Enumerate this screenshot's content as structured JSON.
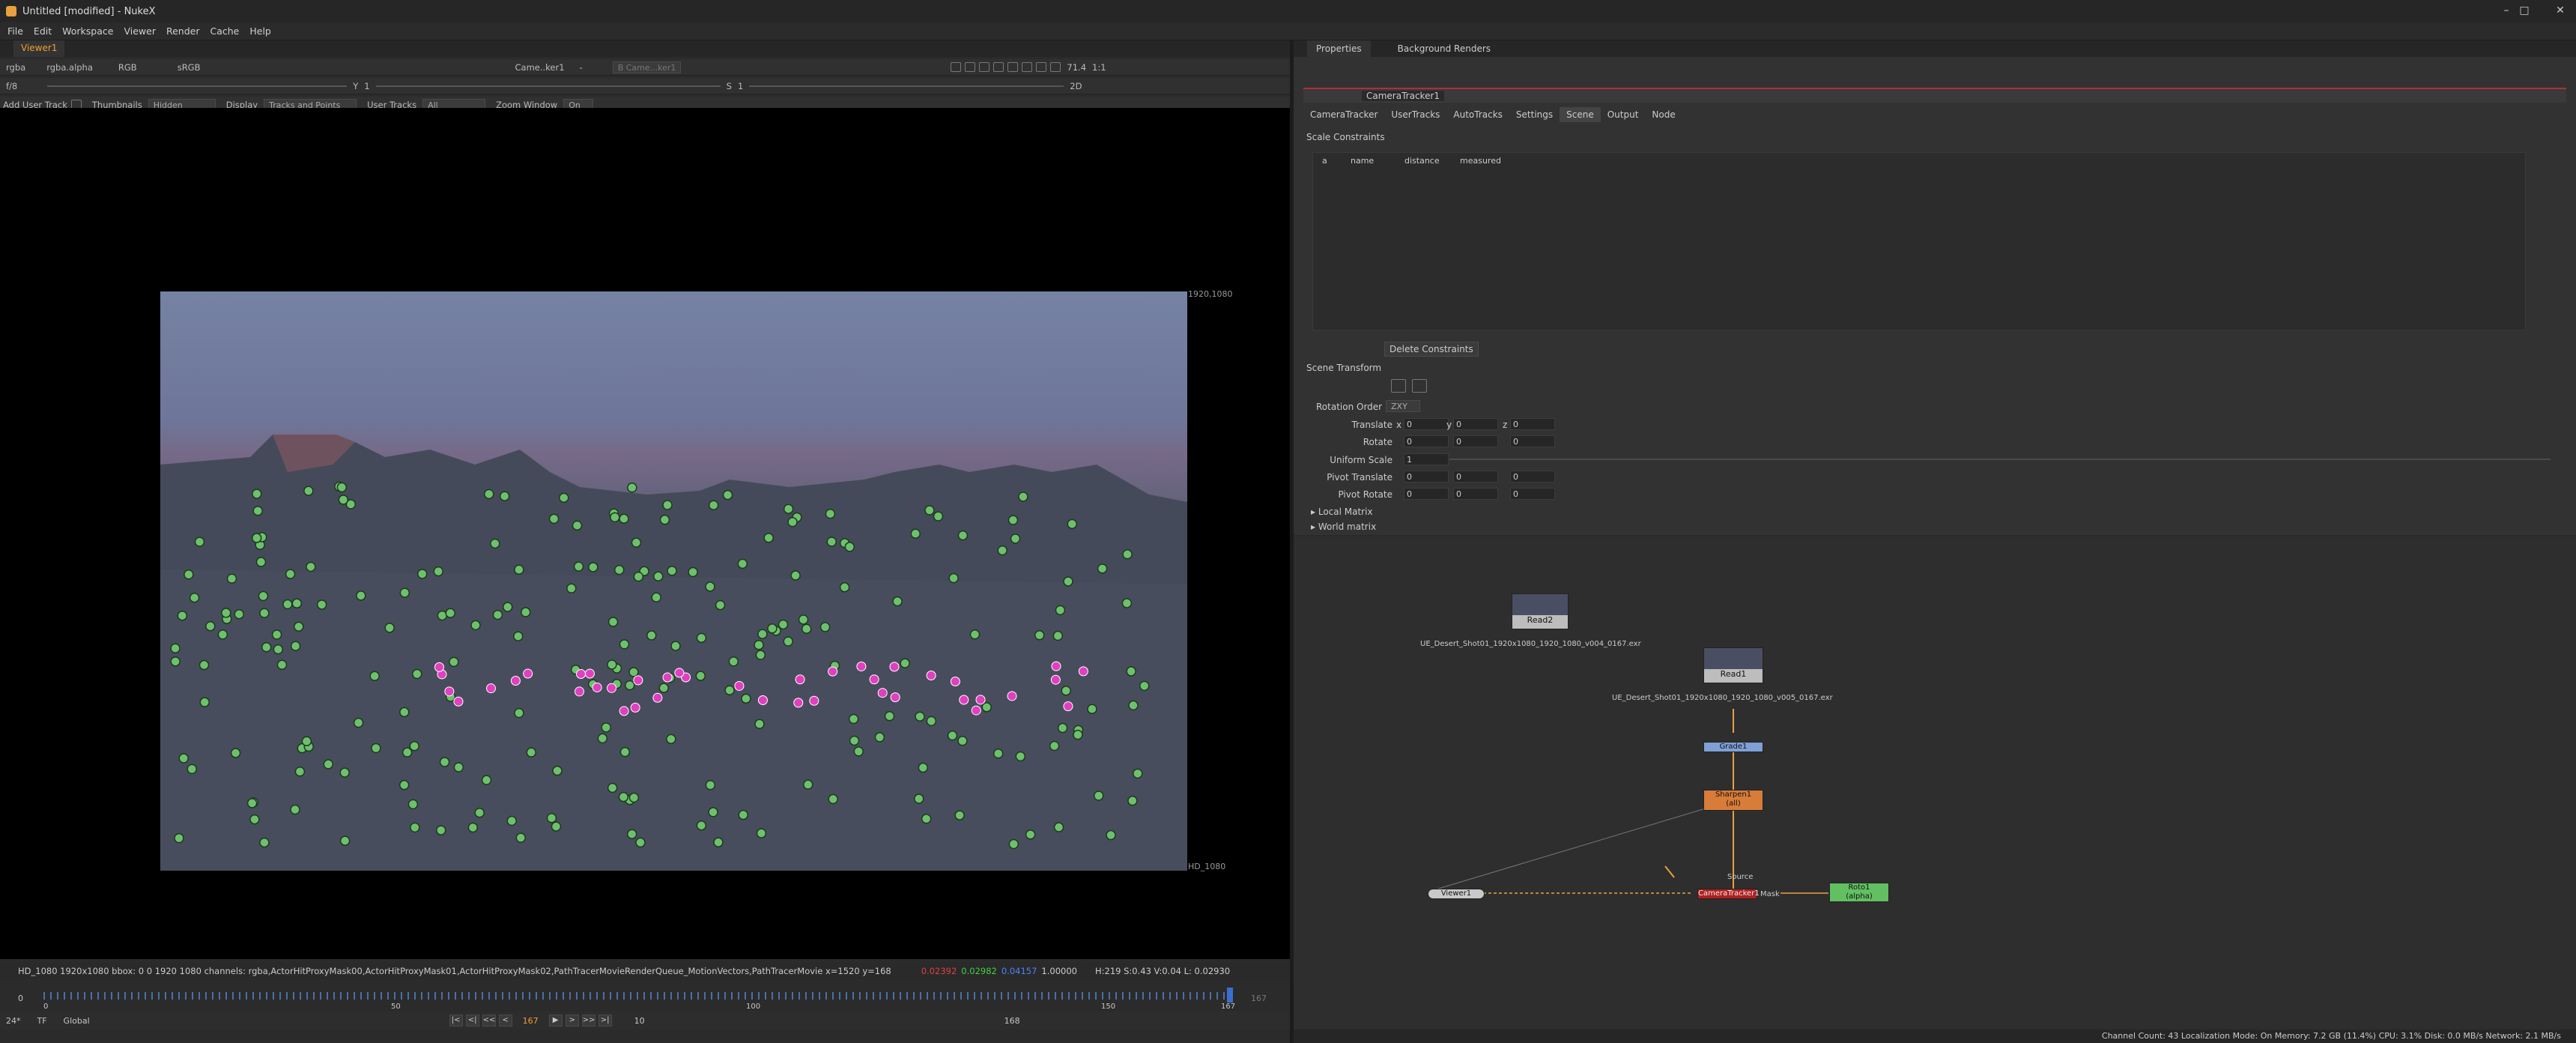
{
  "window": {
    "title": "Untitled [modified] - NukeX"
  },
  "menu": [
    "File",
    "Edit",
    "Workspace",
    "Viewer",
    "Render",
    "Cache",
    "Help"
  ],
  "viewer": {
    "tab": "Viewer1",
    "channels": "rgba",
    "channel_alpha": "rgba.alpha",
    "display_ch": "RGB",
    "colorspace": "sRGB",
    "input_a": "Came..ker1",
    "input_b": "B  Came...ker1",
    "dash": "-",
    "zoom": "71.4",
    "ratio": "1:1",
    "frame_field": "f/8",
    "y_label": "Y",
    "y_val": "1",
    "s_label": "S",
    "s_val": "1",
    "mode_2d": "2D",
    "tools": {
      "add_user_track": "Add User Track",
      "thumbnails_label": "Thumbnails",
      "thumbnails_value": "Hidden",
      "display_label": "Display",
      "display_value": "Tracks and Points",
      "user_tracks_label": "User Tracks",
      "user_tracks_value": "All",
      "zoom_window_label": "Zoom Window",
      "zoom_window_value": "On"
    },
    "format_top": "1920,1080",
    "format_bottom": "HD_1080",
    "info": "HD_1080 1920x1080  bbox: 0 0 1920 1080 channels: rgba,ActorHitProxyMask00,ActorHitProxyMask01,ActorHitProxyMask02,PathTracerMovieRenderQueue_MotionVectors,PathTracerMovie  x=1520 y=168",
    "pixel_r": "0.02392",
    "pixel_g": "0.02982",
    "pixel_b": "0.04157",
    "pixel_a": "1.00000",
    "hsvl": "H:219 S:0.43 V:0.04  L: 0.02930",
    "timeline": {
      "start": "0",
      "end": "167",
      "ticks": [
        "0",
        "50",
        "100",
        "150",
        "167"
      ],
      "current": "167"
    },
    "playbar": {
      "fps": "24*",
      "tf": "TF",
      "scope": "Global",
      "frame": "167",
      "step": "10",
      "end_frame": "168"
    }
  },
  "properties": {
    "tabs": [
      "Properties",
      "Background Renders"
    ],
    "node_name": "CameraTracker1",
    "node_tabs": [
      "CameraTracker",
      "UserTracks",
      "AutoTracks",
      "Settings",
      "Scene",
      "Output",
      "Node"
    ],
    "active_tab": "Scene",
    "scale_constraints": "Scale Constraints",
    "columns": [
      "a",
      "name",
      "distance",
      "measured"
    ],
    "delete_constraints": "Delete Constraints",
    "scene_transform": "Scene Transform",
    "rotation_order_label": "Rotation Order",
    "rotation_order": "ZXY",
    "rows": [
      {
        "label": "Translate",
        "x": "0",
        "y": "0",
        "z": "0"
      },
      {
        "label": "Rotate",
        "x": "0",
        "y": "0",
        "z": "0"
      },
      {
        "label": "Pivot Translate",
        "x": "0",
        "y": "0",
        "z": "0"
      },
      {
        "label": "Pivot Rotate",
        "x": "0",
        "y": "0",
        "z": "0"
      }
    ],
    "uniform_scale_label": "Uniform Scale",
    "uniform_scale": "1",
    "local_matrix": "Local Matrix",
    "world_matrix": "World matrix"
  },
  "nodegraph": {
    "read2": "Read2",
    "read2_file": "UE_Desert_Shot01_1920x1080_1920_1080_v004_0167.exr",
    "read1": "Read1",
    "read1_file": "UE_Desert_Shot01_1920x1080_1920_1080_v005_0167.exr",
    "grade": "Grade1",
    "sharpen": "Sharpen1",
    "sharpen_sub": "(all)",
    "cameratracker": "CameraTracker1",
    "source": "Source",
    "mask": "Mask",
    "roto": "Roto1",
    "roto_sub": "(alpha)",
    "viewer": "Viewer1",
    "colors": {
      "read": "#bdbdbd",
      "grade": "#7f9fd6",
      "sharpen": "#d87c3a",
      "cameratracker": "#b02020",
      "roto": "#62c062",
      "viewer": "#c9c9c9"
    }
  },
  "status": "Channel Count: 43 Localization Mode: On Memory: 7.2 GB (11.4%) CPU: 3.1% Disk: 0.0 MB/s Network: 2.1 MB/s"
}
